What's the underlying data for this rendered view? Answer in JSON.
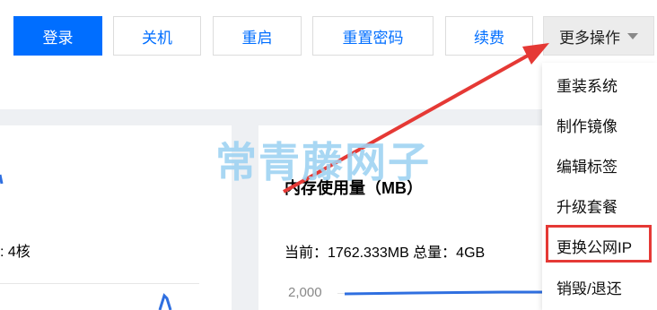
{
  "toolbar": {
    "login_label": "登录",
    "shutdown_label": "关机",
    "restart_label": "重启",
    "reset_password_label": "重置密码",
    "renew_label": "续费",
    "more_actions_label": "更多操作"
  },
  "dropdown": {
    "items": [
      "重装系统",
      "制作镜像",
      "编辑标签",
      "升级套餐",
      "更换公网IP",
      "销毁/退还"
    ],
    "highlighted_item": "更换公网IP"
  },
  "panels": {
    "left_cores_text": ": 4核",
    "memory": {
      "title": "内存使用量（MB）",
      "stats": "当前：1762.333MB 总量：4GB",
      "y_tick": "2,000"
    }
  },
  "watermark": "常青藤网子",
  "colors": {
    "primary_blue": "#006eff",
    "annotation_red": "#e53935",
    "watermark": "#9fd3f2",
    "chart_line": "#2f6fe0"
  }
}
